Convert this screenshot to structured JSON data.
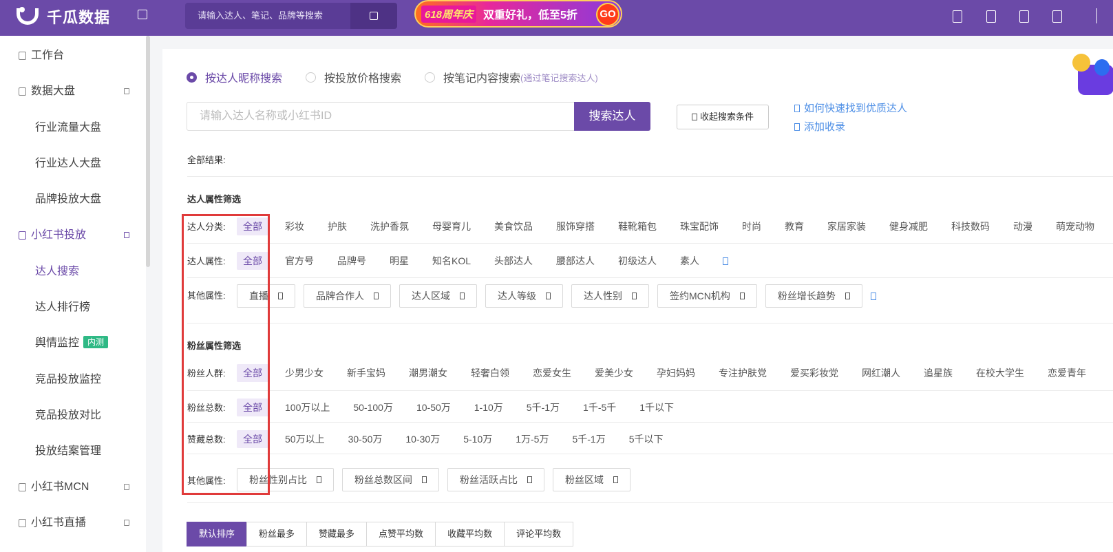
{
  "header": {
    "logo_text": "千瓜数据",
    "search_placeholder": "请输入达人、笔记、品牌等搜索",
    "promo_tag": "618周年庆",
    "promo_text": "双重好礼，低至5折",
    "promo_go": "GO"
  },
  "sidebar": {
    "items": [
      {
        "label": "工作台",
        "type": "top"
      },
      {
        "label": "数据大盘",
        "type": "top"
      },
      {
        "label": "行业流量大盘",
        "type": "sub"
      },
      {
        "label": "行业达人大盘",
        "type": "sub"
      },
      {
        "label": "品牌投放大盘",
        "type": "sub"
      },
      {
        "label": "小红书投放",
        "type": "top"
      },
      {
        "label": "达人搜索",
        "type": "sub"
      },
      {
        "label": "达人排行榜",
        "type": "sub"
      },
      {
        "label": "舆情监控",
        "type": "sub",
        "badge": "内测"
      },
      {
        "label": "竞品投放监控",
        "type": "sub"
      },
      {
        "label": "竞品投放对比",
        "type": "sub"
      },
      {
        "label": "投放结案管理",
        "type": "sub"
      },
      {
        "label": "小红书MCN",
        "type": "top"
      },
      {
        "label": "小红书直播",
        "type": "top"
      }
    ],
    "active_item": "达人搜索"
  },
  "search": {
    "modes": [
      "按达人昵称搜索",
      "按投放价格搜索",
      "按笔记内容搜索"
    ],
    "mode_hint": "(通过笔记搜索达人)",
    "selected_mode": "按达人昵称搜索",
    "input_placeholder": "请输入达人名称或小红书ID",
    "submit_label": "搜索达人",
    "collapse_label": "收起搜索条件",
    "help_links": [
      "如何快速找到优质达人",
      "添加收录"
    ]
  },
  "results_label": "全部结果:",
  "influencer_filters": {
    "title": "达人属性筛选",
    "category": {
      "label": "达人分类:",
      "all": "全部",
      "options": [
        "彩妆",
        "护肤",
        "洗护香氛",
        "母婴育儿",
        "美食饮品",
        "服饰穿搭",
        "鞋靴箱包",
        "珠宝配饰",
        "时尚",
        "教育",
        "家居家装",
        "健身减肥",
        "科技数码",
        "动漫",
        "萌宠动物"
      ]
    },
    "attribute": {
      "label": "达人属性:",
      "all": "全部",
      "options": [
        "官方号",
        "品牌号",
        "明星",
        "知名KOL",
        "头部达人",
        "腰部达人",
        "初级达人",
        "素人"
      ]
    },
    "other": {
      "label": "其他属性:",
      "dropdowns": [
        "直播",
        "品牌合作人",
        "达人区域",
        "达人等级",
        "达人性别",
        "签约MCN机构",
        "粉丝增长趋势"
      ]
    }
  },
  "fan_filters": {
    "title": "粉丝属性筛选",
    "crowd": {
      "label": "粉丝人群:",
      "all": "全部",
      "options": [
        "少男少女",
        "新手宝妈",
        "潮男潮女",
        "轻奢白领",
        "恋爱女生",
        "爱美少女",
        "孕妇妈妈",
        "专注护肤党",
        "爱买彩妆党",
        "网红潮人",
        "追星族",
        "在校大学生",
        "恋爱青年"
      ]
    },
    "total": {
      "label": "粉丝总数:",
      "all": "全部",
      "options": [
        "100万以上",
        "50-100万",
        "10-50万",
        "1-10万",
        "5千-1万",
        "1千-5千",
        "1千以下"
      ]
    },
    "likes": {
      "label": "赞藏总数:",
      "all": "全部",
      "options": [
        "50万以上",
        "30-50万",
        "10-30万",
        "5-10万",
        "1万-5万",
        "5千-1万",
        "5千以下"
      ]
    },
    "other": {
      "label": "其他属性:",
      "dropdowns": [
        "粉丝性别占比",
        "粉丝总数区间",
        "粉丝活跃占比",
        "粉丝区域"
      ]
    }
  },
  "sort": {
    "options": [
      "默认排序",
      "粉丝最多",
      "赞藏最多",
      "点赞平均数",
      "收藏平均数",
      "评论平均数"
    ],
    "selected": "默认排序"
  },
  "colors": {
    "brand": "#6b4aa8",
    "link": "#4e8fe6",
    "highlight_box": "#e03a3a",
    "badge": "#2fb985"
  }
}
